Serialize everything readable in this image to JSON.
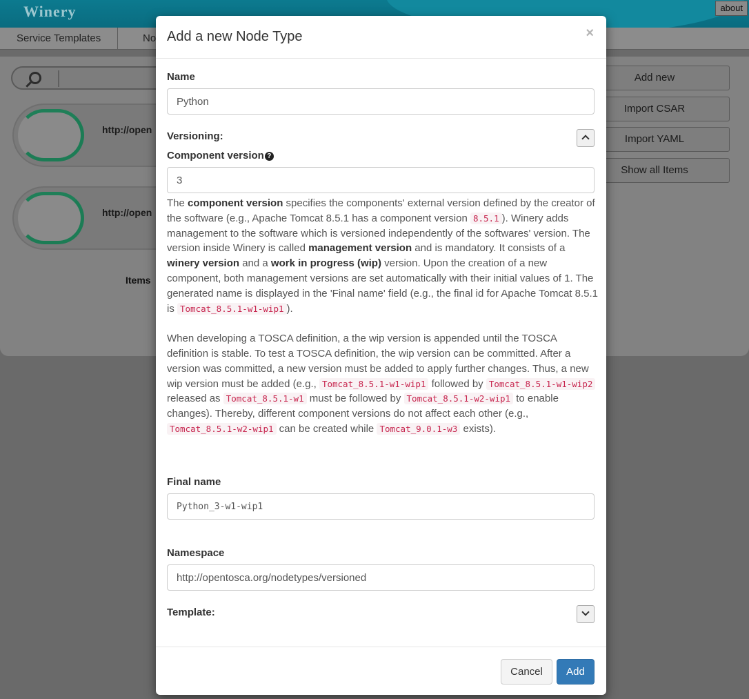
{
  "app": {
    "brand": "Winery",
    "about_label": "about",
    "nav_tabs": [
      "Service Templates",
      "No"
    ],
    "cards": [
      {
        "namespace": "http://open"
      },
      {
        "namespace": "http://open"
      }
    ],
    "items_label": "Items",
    "side_buttons": [
      "Add new",
      "Import CSAR",
      "Import YAML",
      "Show all Items"
    ]
  },
  "modal": {
    "title": "Add a new Node Type",
    "close_label": "×",
    "name_label": "Name",
    "name_value": "Python",
    "versioning_label": "Versioning:",
    "component_version_label": "Component version",
    "component_version_value": "3",
    "help_icon": "?",
    "desc": {
      "t1": "The ",
      "b1": "component version",
      "t2": " specifies the components' external version defined by the creator of the software (e.g., Apache Tomcat 8.5.1 has a component version ",
      "c1": "8.5.1",
      "t3": "). Winery adds management to the software which is versioned independently of the softwares' version. The version inside Winery is called ",
      "b2": "management version",
      "t4": " and is mandatory. It consists of a ",
      "b3": "winery version",
      "t5": " and a ",
      "b4": "work in progress (wip)",
      "t6": " version. Upon the creation of a new component, both management versions are set automatically with their initial values of 1. The generated name is displayed in the 'Final name' field (e.g., the final id for Apache Tomcat 8.5.1 is ",
      "c2": "Tomcat_8.5.1-w1-wip1",
      "t7": ").",
      "p2_t1": "When developing a TOSCA definition, a the wip version is appended until the TOSCA definition is stable. To test a TOSCA definition, the wip version can be committed. After a version was committed, a new version must be added to apply further changes. Thus, a new wip version must be added (e.g., ",
      "p2_c1": "Tomcat_8.5.1-w1-wip1",
      "p2_t2": " followed by ",
      "p2_c2": "Tomcat_8.5.1-w1-wip2",
      "p2_t3": " released as ",
      "p2_c3": "Tomcat_8.5.1-w1",
      "p2_t4": " must be followed by ",
      "p2_c4": "Tomcat_8.5.1-w2-wip1",
      "p2_t5": " to enable changes). Thereby, different component versions do not affect each other (e.g., ",
      "p2_c5": "Tomcat_8.5.1-w2-wip1",
      "p2_t6": " can be created while ",
      "p2_c6": "Tomcat_9.0.1-w3",
      "p2_t7": " exists)."
    },
    "final_name_label": "Final name",
    "final_name_value": "Python_3-w1-wip1",
    "namespace_label": "Namespace",
    "namespace_value": "http://opentosca.org/nodetypes/versioned",
    "template_label": "Template:",
    "cancel_label": "Cancel",
    "add_label": "Add"
  }
}
